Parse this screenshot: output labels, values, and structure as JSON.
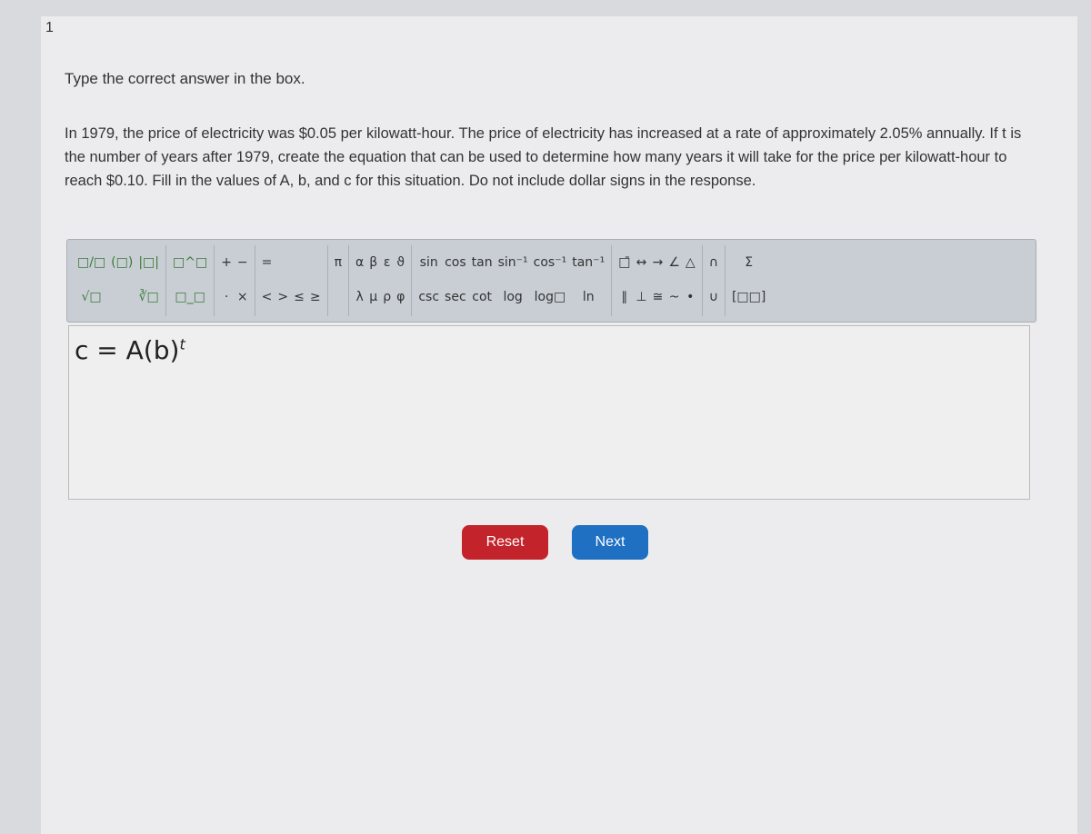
{
  "question_number": "1",
  "instruction": "Type the correct answer in the box.",
  "question": "In 1979, the price of electricity was $0.05 per kilowatt-hour. The price of electricity has increased at a rate of approximately 2.05% annually. If t is the number of years after 1979, create the equation that can be used to determine how many years it will take for the price per kilowatt-hour to reach $0.10. Fill in the values of A, b, and c for this situation. Do not include dollar signs in the response.",
  "toolbar": {
    "groups": [
      {
        "name": "templates",
        "items": [
          "□/□",
          "√□",
          "(□)",
          "",
          "|□|",
          "∛□"
        ],
        "green": true
      },
      {
        "name": "scripts",
        "items": [
          "□^□",
          "□_□"
        ],
        "green": true
      },
      {
        "name": "operators",
        "items": [
          "+",
          "·",
          "−",
          "×"
        ]
      },
      {
        "name": "relations",
        "items": [
          "=",
          "<",
          "",
          ">",
          "",
          "≤",
          "",
          "≥"
        ]
      },
      {
        "name": "pi",
        "items": [
          "π",
          ""
        ]
      },
      {
        "name": "greek",
        "items": [
          "α",
          "λ",
          "β",
          "μ",
          "ε",
          "ρ",
          "ϑ",
          "φ"
        ]
      },
      {
        "name": "trig",
        "items": [
          "sin",
          "csc",
          "cos",
          "sec",
          "tan",
          "cot",
          "sin⁻¹",
          "log",
          "cos⁻¹",
          "log□",
          "tan⁻¹",
          "ln"
        ]
      },
      {
        "name": "geometry",
        "items": [
          "□̄",
          "∥",
          "↔",
          "⊥",
          "→",
          "≅",
          "∠",
          "~",
          "△",
          "•"
        ]
      },
      {
        "name": "sets",
        "items": [
          "∩",
          "∪"
        ]
      },
      {
        "name": "misc",
        "items": [
          "Σ",
          "[□□]"
        ]
      }
    ]
  },
  "answer": {
    "equation": "c = A(b)",
    "exponent": "t"
  },
  "buttons": {
    "reset": "Reset",
    "next": "Next"
  },
  "colors": {
    "reset": "#c3242c",
    "next": "#1f6fc2",
    "symbol_green": "#3a7a3a"
  }
}
